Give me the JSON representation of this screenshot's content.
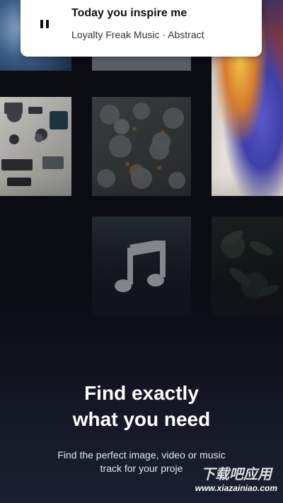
{
  "now_playing": {
    "title": "Today you inspire me",
    "artist": "Loyalty Freak Music",
    "separator": "·",
    "genre": "Abstract",
    "state": "playing"
  },
  "icons": {
    "pause": "pause-icon",
    "music": "music-note-icon"
  },
  "onboarding": {
    "headline_line1": "Find exactly",
    "headline_line2": "what you need",
    "subtext_line1": "Find the perfect image, video or music",
    "subtext_line2": "track for your proje"
  },
  "watermark": {
    "text_cn": "下载吧应用",
    "url": "www.xiazainiao.com"
  },
  "colors": {
    "background": "#0b0c12",
    "card": "#ffffff",
    "headline": "#ffffff"
  }
}
